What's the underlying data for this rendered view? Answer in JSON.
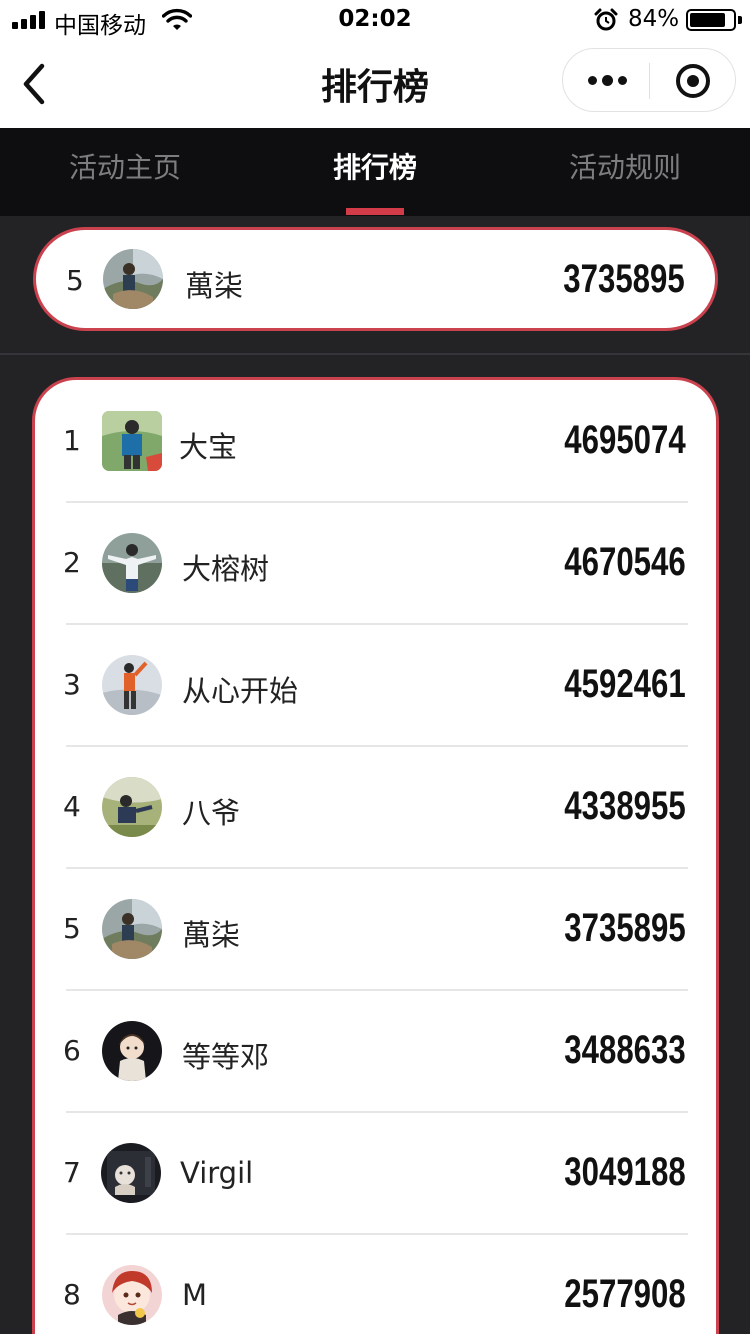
{
  "status_bar": {
    "carrier": "中国移动",
    "time": "02:02",
    "battery_percent": "84%",
    "battery_level": 0.84,
    "icons": [
      "signal-icon",
      "wifi-icon",
      "alarm-icon",
      "battery-icon"
    ]
  },
  "nav": {
    "title": "排行榜",
    "icons": [
      "back-icon",
      "more-icon",
      "close-target-icon"
    ]
  },
  "tabs": [
    {
      "label": "活动主页",
      "active": false
    },
    {
      "label": "排行榜",
      "active": true
    },
    {
      "label": "活动规则",
      "active": false
    }
  ],
  "my_rank": {
    "rank": "5",
    "name": "萬柒",
    "score": "3735895",
    "avatar": "avatar-photo-5"
  },
  "leaderboard": [
    {
      "rank": "1",
      "name": "大宝",
      "score": "4695074",
      "avatar": "avatar-photo-1"
    },
    {
      "rank": "2",
      "name": "大榕树",
      "score": "4670546",
      "avatar": "avatar-photo-2"
    },
    {
      "rank": "3",
      "name": "从心开始",
      "score": "4592461",
      "avatar": "avatar-photo-3"
    },
    {
      "rank": "4",
      "name": "八爷",
      "score": "4338955",
      "avatar": "avatar-photo-4"
    },
    {
      "rank": "5",
      "name": "萬柒",
      "score": "3735895",
      "avatar": "avatar-photo-5"
    },
    {
      "rank": "6",
      "name": "等等邓",
      "score": "3488633",
      "avatar": "avatar-cartoon-6"
    },
    {
      "rank": "7",
      "name": "Virgil",
      "score": "3049188",
      "avatar": "avatar-photo-7"
    },
    {
      "rank": "8",
      "name": "M",
      "score": "2577908",
      "avatar": "avatar-cartoon-8"
    }
  ],
  "colors": {
    "page_background": "#232325",
    "tab_bar_background": "#0e0e10",
    "accent_red": "#c9424d",
    "tab_active": "#ffffff",
    "tab_inactive": "#7d7d80"
  }
}
